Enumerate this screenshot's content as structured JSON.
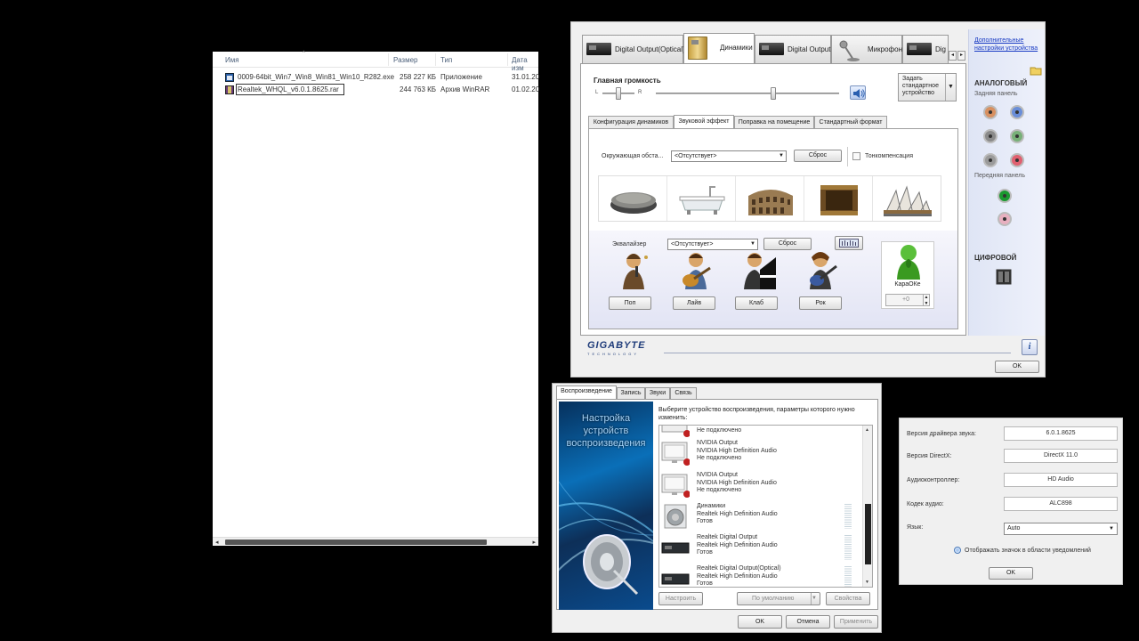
{
  "explorer": {
    "columns": [
      "Имя",
      "Размер",
      "Тип",
      "Дата изм"
    ],
    "files": [
      {
        "name": "0009-64bit_Win7_Win8_Win81_Win10_R282.exe",
        "size": "258 227 КБ",
        "type": "Приложение",
        "date": "31.01.20"
      },
      {
        "name": "Realtek_WHQL_v6.0.1.8625.rar",
        "size": "244 763 КБ",
        "type": "Архив WinRAR",
        "date": "01.02.20"
      }
    ]
  },
  "realtek": {
    "device_tabs": [
      "Digital Output(Optical)",
      "Динамики",
      "Digital Output",
      "Микрофон",
      "Dig"
    ],
    "active_device_tab": "Динамики",
    "main_volume_label": "Главная громкость",
    "left_label": "L",
    "right_label": "R",
    "balance_percent": 50,
    "volume_percent": 64,
    "set_default_label": "Задать стандартное устройство",
    "sub_tabs": [
      "Конфигурация динамиков",
      "Звуковой эффект",
      "Поправка на помещение",
      "Стандартный формат"
    ],
    "active_sub_tab": "Звуковой эффект",
    "environment_label": "Окружающая обста...",
    "environment_value": "<Отсутствует>",
    "reset_label": "Сброс",
    "loudness_label": "Тонкомпенсация",
    "environments": [
      "stone-icon",
      "bathtub-icon",
      "colosseum-icon",
      "stage-icon",
      "opera-house-icon"
    ],
    "equalizer_label": "Эквалайзер",
    "equalizer_value": "<Отсутствует>",
    "eq_reset_label": "Сброс",
    "genres": [
      "Поп",
      "Лайв",
      "Клаб",
      "Рок"
    ],
    "karaoke_label": "КараОКе",
    "karaoke_value": "+0",
    "sidebar": {
      "link": "Дополнительные настройки устройства",
      "analog_title": "АНАЛОГОВЫЙ",
      "back_panel": "Задняя панель",
      "front_panel": "Передняя панель",
      "digital_title": "ЦИФРОВОЙ"
    },
    "brand": "GIGABYTE",
    "brand_sub": "TECHNOLOGY",
    "ok_label": "OK",
    "colors": {
      "accent": "#1f3c7a",
      "link": "#1a3cc4"
    }
  },
  "playback": {
    "tabs": [
      "Воспроизведение",
      "Запись",
      "Звуки",
      "Связь"
    ],
    "active_tab": "Воспроизведение",
    "banner_title": "Настройка устройств воспроизведения",
    "description": "Выберите устройство воспроизведения, параметры которого нужно изменить:",
    "partial_item_status": "Не подключено",
    "devices": [
      {
        "name": "NVIDIA Output",
        "driver": "NVIDIA High Definition Audio",
        "status": "Не подключено",
        "icon": "monitor-icon"
      },
      {
        "name": "NVIDIA Output",
        "driver": "NVIDIA High Definition Audio",
        "status": "Не подключено",
        "icon": "monitor-icon"
      },
      {
        "name": "Динамики",
        "driver": "Realtek High Definition Audio",
        "status": "Готов",
        "icon": "speaker-icon"
      },
      {
        "name": "Realtek Digital Output",
        "driver": "Realtek High Definition Audio",
        "status": "Готов",
        "icon": "digital-output-icon"
      },
      {
        "name": "Realtek Digital Output(Optical)",
        "driver": "Realtek High Definition Audio",
        "status": "Готов",
        "icon": "digital-output-icon"
      }
    ],
    "configure_label": "Настроить",
    "default_label": "По умолчанию",
    "properties_label": "Свойства",
    "ok_label": "OK",
    "cancel_label": "Отмена",
    "apply_label": "Применить"
  },
  "info": {
    "driver_version_label": "Версия драйвера звука:",
    "driver_version": "6.0.1.8625",
    "directx_label": "Версия DirectX:",
    "directx": "DirectX 11.0",
    "controller_label": "Аудиоконтроллер:",
    "controller": "HD Audio",
    "codec_label": "Кодек аудио:",
    "codec": "ALC898",
    "language_label": "Язык:",
    "language": "Auto",
    "tray_label": "Отображать значок в области уведомлений",
    "ok_label": "OK"
  }
}
